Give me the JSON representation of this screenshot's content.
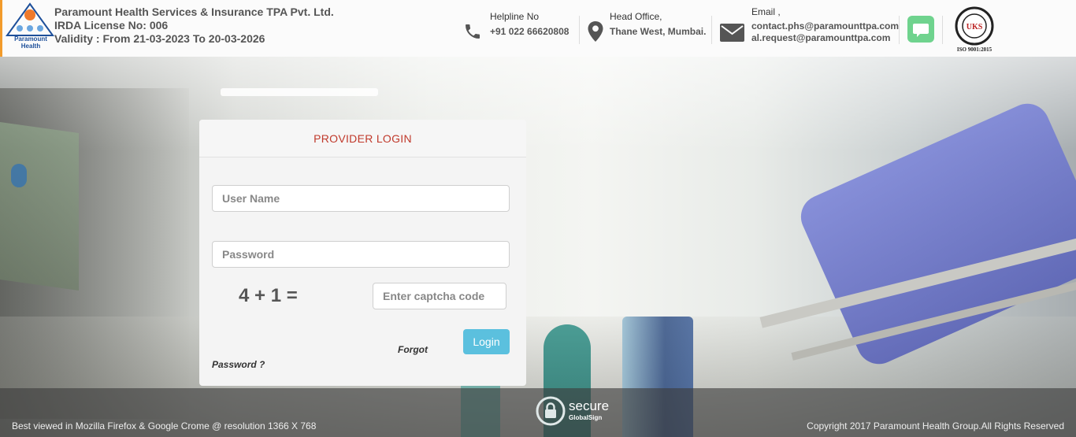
{
  "header": {
    "logo_text": "Paramount Health",
    "company_name": "Paramount Health Services & Insurance TPA Pvt. Ltd.",
    "license": "IRDA License No: 006",
    "validity": "Validity : From 21-03-2023 To 20-03-2026",
    "helpline": {
      "label": "Helpline No",
      "value": "+91 022 66620808"
    },
    "office": {
      "label": "Head Office,",
      "value": "Thane West, Mumbai."
    },
    "email": {
      "label": "Email ,",
      "value1": "contact.phs@paramounttpa.com",
      "value2": "al.request@paramounttpa.com"
    },
    "iso_label": "ISO 9001:2015",
    "iso_badge": "UKS"
  },
  "login": {
    "title": "PROVIDER LOGIN",
    "username_placeholder": "User Name",
    "password_placeholder": "Password",
    "captcha_question": "4 + 1 =",
    "captcha_placeholder": "Enter captcha code",
    "login_button": "Login",
    "forgot_line1": "Forgot",
    "forgot_line2": "Password ?"
  },
  "footer": {
    "browser_note": "Best viewed in Mozilla Firefox & Google Crome @ resolution 1366 X 768",
    "copyright": "Copyright 2017 Paramount Health Group.All Rights Reserved",
    "secure_title": "secure",
    "secure_sub": "GlobalSign"
  },
  "colors": {
    "accent_orange": "#f29b2b",
    "login_title": "#c0392b",
    "login_button": "#5bc0de",
    "chat_button": "#6fd38e"
  },
  "icons": [
    "phone-icon",
    "location-icon",
    "mail-icon",
    "chat-icon",
    "lock-icon"
  ]
}
